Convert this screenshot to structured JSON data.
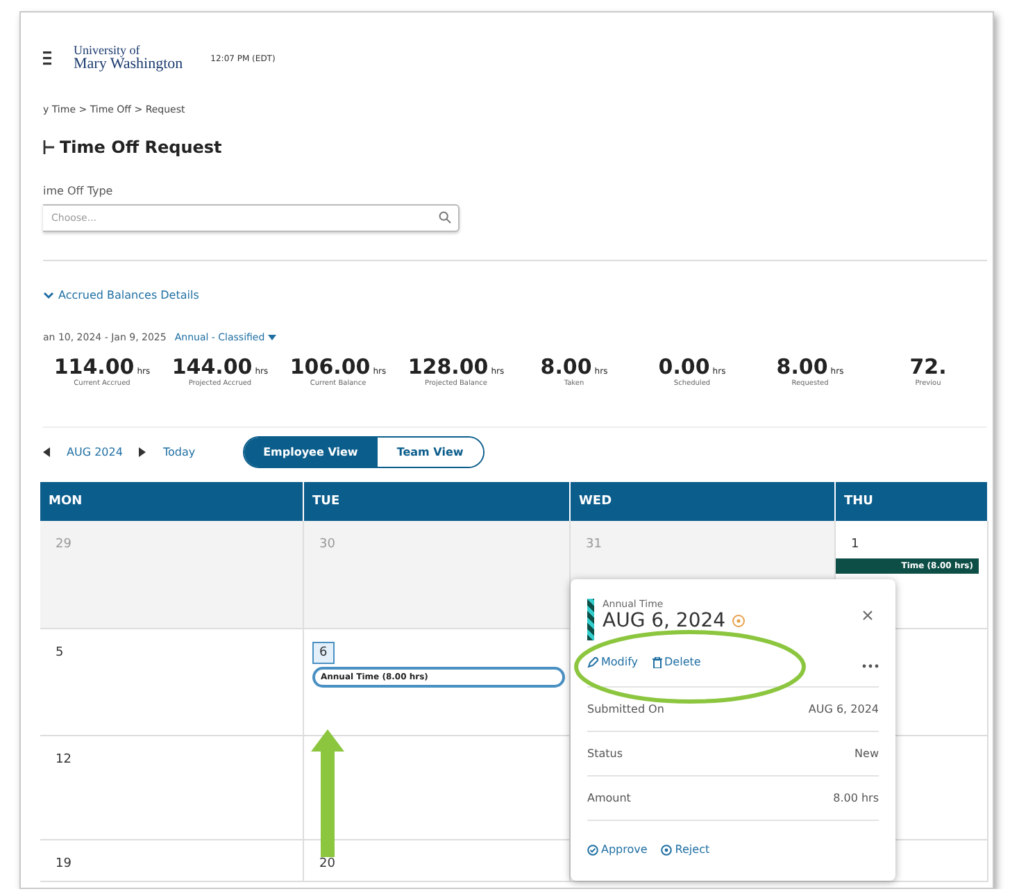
{
  "header": {
    "logo_line1": "University of",
    "logo_line2": "Mary Washington",
    "time": "12:07 PM (EDT)"
  },
  "breadcrumb": "y Time > Time Off > Request",
  "title": "Time Off Request",
  "time_off_type": {
    "label": "ime Off Type",
    "placeholder": "Choose..."
  },
  "accrued_toggle": {
    "label": "Accrued Balances Details",
    "expanded": true
  },
  "period": {
    "range": "an 10, 2024 - Jan 9, 2025",
    "plan": "Annual - Classified"
  },
  "balances": [
    {
      "value": "114.00",
      "unit": "hrs",
      "label": "Current Accrued"
    },
    {
      "value": "144.00",
      "unit": "hrs",
      "label": "Projected Accrued"
    },
    {
      "value": "106.00",
      "unit": "hrs",
      "label": "Current Balance"
    },
    {
      "value": "128.00",
      "unit": "hrs",
      "label": "Projected Balance"
    },
    {
      "value": "8.00",
      "unit": "hrs",
      "label": "Taken"
    },
    {
      "value": "0.00",
      "unit": "hrs",
      "label": "Scheduled"
    },
    {
      "value": "8.00",
      "unit": "hrs",
      "label": "Requested"
    },
    {
      "value": "72.",
      "label": "Previou"
    }
  ],
  "calendar_nav": {
    "month": "AUG 2024",
    "today": "Today"
  },
  "views": [
    {
      "label": "Employee View",
      "selected": true
    },
    {
      "label": "Team View",
      "selected": false
    }
  ],
  "calendar": {
    "columns": [
      "MON",
      "TUE",
      "WED",
      "THU"
    ],
    "weeks": [
      {
        "days": [
          {
            "label": "29",
            "muted": true,
            "selected": false
          },
          {
            "label": "30",
            "muted": true,
            "selected": false
          },
          {
            "label": "31",
            "muted": true,
            "selected": false
          },
          {
            "label": "1",
            "muted": false,
            "selected": false,
            "event": {
              "kind": "approved",
              "text": "Time (8.00 hrs)"
            }
          }
        ]
      },
      {
        "days": [
          {
            "label": "5",
            "muted": false,
            "selected": false
          },
          {
            "label": "6",
            "muted": false,
            "selected": true,
            "event": {
              "kind": "pending",
              "text": "Annual Time (8.00 hrs)"
            }
          }
        ]
      },
      {
        "days": [
          {
            "label": "12",
            "muted": false,
            "selected": false
          }
        ]
      },
      {
        "days": [
          {
            "label": "19",
            "muted": false,
            "selected": false
          },
          {
            "label": "20",
            "muted": false,
            "selected": false
          }
        ]
      }
    ]
  },
  "popover": {
    "type": "Annual Time",
    "date": "AUG 6, 2024",
    "actions": [
      "Modify",
      "Delete"
    ],
    "details": [
      {
        "label": "Submitted On",
        "value": "AUG 6, 2024"
      },
      {
        "label": "Status",
        "value": "New"
      },
      {
        "label": "Amount",
        "value": "8.00 hrs"
      }
    ],
    "decisions": [
      "Approve",
      "Reject"
    ]
  }
}
